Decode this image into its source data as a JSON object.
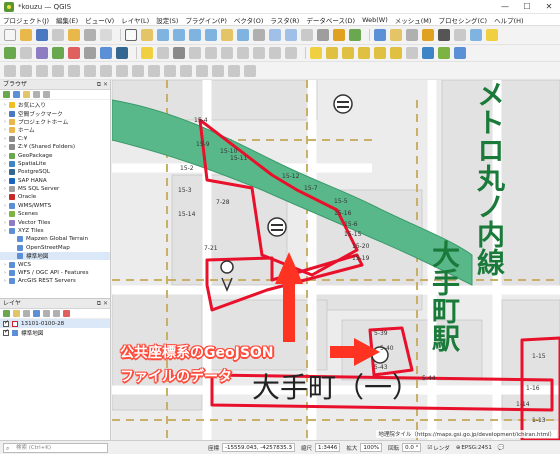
{
  "window": {
    "title": "*kouzu — QGIS",
    "controls": [
      "—",
      "☐",
      "✕"
    ]
  },
  "menu": [
    "プロジェクト(J)",
    "編集(E)",
    "ビュー(V)",
    "レイヤ(L)",
    "設定(S)",
    "プラグイン(P)",
    "ベクタ(O)",
    "ラスタ(R)",
    "データベース(D)",
    "Web(W)",
    "メッシュ(M)",
    "プロセシング(C)",
    "ヘルプ(H)"
  ],
  "browser_panel": {
    "title": "ブラウザ",
    "items": [
      {
        "label": "お気に入り",
        "icon": "star-icon",
        "color": "#f0c020",
        "indent": 0
      },
      {
        "label": "空間ブックマーク",
        "icon": "bookmark-icon",
        "color": "#4a78c0",
        "indent": 0
      },
      {
        "label": "プロジェクトホーム",
        "icon": "folder-icon",
        "color": "#e8b84a",
        "indent": 0
      },
      {
        "label": "ホーム",
        "icon": "folder-icon",
        "color": "#e8b84a",
        "indent": 0
      },
      {
        "label": "C:¥",
        "icon": "drive-icon",
        "color": "#8a8a8a",
        "indent": 0
      },
      {
        "label": "Z:¥ (Shared Folders)",
        "icon": "drive-icon",
        "color": "#8a8a8a",
        "indent": 0
      },
      {
        "label": "GeoPackage",
        "icon": "geopackage-icon",
        "color": "#6aa84f",
        "indent": 0
      },
      {
        "label": "SpatiaLite",
        "icon": "spatialite-icon",
        "color": "#3d85c6",
        "indent": 0
      },
      {
        "label": "PostgreSQL",
        "icon": "postgresql-icon",
        "color": "#336791",
        "indent": 0
      },
      {
        "label": "SAP HANA",
        "icon": "sap-hana-icon",
        "color": "#1565c0",
        "indent": 0
      },
      {
        "label": "MS SQL Server",
        "icon": "mssql-icon",
        "color": "#9e9e9e",
        "indent": 0
      },
      {
        "label": "Oracle",
        "icon": "oracle-icon",
        "color": "#c62828",
        "indent": 0
      },
      {
        "label": "WMS/WMTS",
        "icon": "globe-icon",
        "color": "#5b8fd6",
        "indent": 0
      },
      {
        "label": "Scenes",
        "icon": "scenes-icon",
        "color": "#7cb342",
        "indent": 0
      },
      {
        "label": "Vector Tiles",
        "icon": "vector-tiles-icon",
        "color": "#8e7cc3",
        "indent": 0
      },
      {
        "label": "XYZ Tiles",
        "icon": "xyz-tiles-icon",
        "color": "#5b8fd6",
        "indent": 0
      },
      {
        "label": "Mapzen Global Terrain",
        "icon": "tile-icon",
        "color": "#5b8fd6",
        "indent": 1
      },
      {
        "label": "OpenStreetMap",
        "icon": "tile-icon",
        "color": "#5b8fd6",
        "indent": 1
      },
      {
        "label": "標準地図",
        "icon": "tile-icon",
        "color": "#5b8fd6",
        "indent": 1
      },
      {
        "label": "WCS",
        "icon": "globe-icon",
        "color": "#5b8fd6",
        "indent": 0
      },
      {
        "label": "WFS / OGC API - Features",
        "icon": "globe-icon",
        "color": "#5b8fd6",
        "indent": 0
      },
      {
        "label": "ArcGIS REST Servers",
        "icon": "arcgis-icon",
        "color": "#5b8fd6",
        "indent": 0
      }
    ]
  },
  "layers_panel": {
    "title": "レイヤ",
    "items": [
      {
        "label": "13101-0100-28",
        "checked": true,
        "swatch": "#d0202a"
      },
      {
        "label": "標準地図",
        "checked": true,
        "swatch": "#5b8fd6"
      }
    ]
  },
  "map": {
    "labels": {
      "station": "大手町駅",
      "line_name": "メトロ丸ノ内線",
      "district": "大手町（一）",
      "block_codes": [
        "15-4",
        "15-9",
        "15-10",
        "15-11",
        "15-2",
        "15-3",
        "15-12",
        "15-7",
        "15-5",
        "15-6",
        "15-16",
        "15-14",
        "15-15",
        "15-20",
        "15-19",
        "7-28",
        "7-21",
        "5-39",
        "5-40",
        "5-43",
        "5-44",
        "1-15",
        "1-16",
        "1-14",
        "1-13"
      ]
    },
    "annotation": {
      "line1": "公共座標系のGeoJSON",
      "line2": "ファイルのデータ"
    },
    "credit": "地理院タイル（https://maps.gsi.go.jp/development/ichiran.html）",
    "colors": {
      "parcel": "#e8102a",
      "green_band": "#59b88a",
      "street": "#ffffff",
      "building": "#e6e6e6",
      "dash": "#c8b068",
      "station_text": "#1a7a3a"
    }
  },
  "status": {
    "search_placeholder": "検索 (Ctrl+K)",
    "coord_label": "座標",
    "coord_value": "-15559.043, -4257835.3",
    "scale_label": "縮尺",
    "scale_value": "1:3446",
    "magnifier_label": "拡大",
    "magnifier_value": "100%",
    "rotation_label": "回転",
    "rotation_value": "0.0 °",
    "render_label": "レンダ",
    "crs": "EPSG:2451"
  }
}
